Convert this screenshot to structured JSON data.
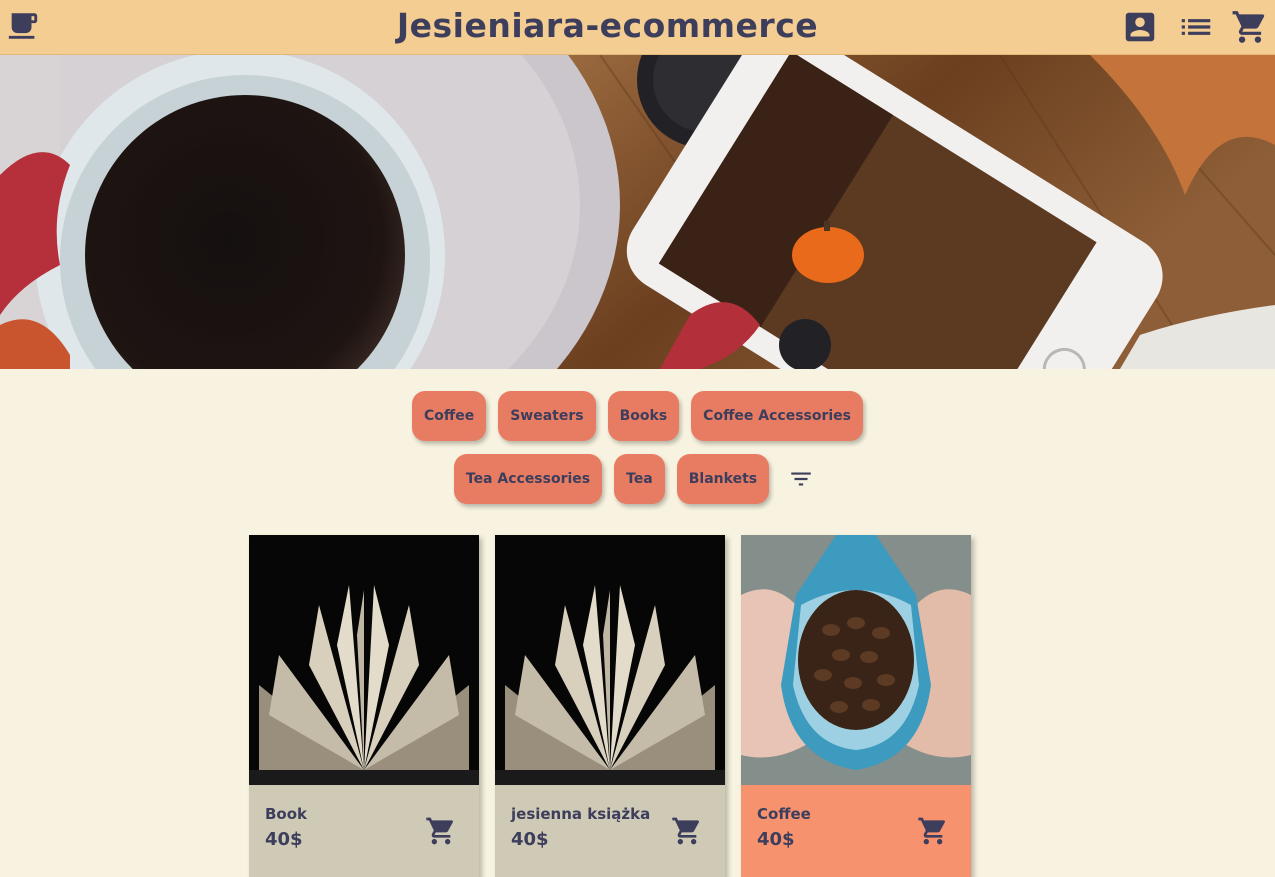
{
  "header": {
    "title": "Jesieniara-ecommerce",
    "logo_icon": "coffee-cup-icon",
    "icons": [
      "account-box-icon",
      "list-icon",
      "shopping-cart-icon"
    ]
  },
  "categories": {
    "row1": [
      "Coffee",
      "Sweaters",
      "Books",
      "Coffee Accessories"
    ],
    "row2": [
      "Tea Accessories",
      "Tea",
      "Blankets"
    ],
    "filter_icon": "filter-list-icon"
  },
  "products": [
    {
      "name": "Book",
      "price": "40$",
      "image": "open-book-photo"
    },
    {
      "name": "jesienna książka",
      "price": "40$",
      "image": "open-book-photo"
    },
    {
      "name": "Coffee",
      "price": "40$",
      "image": "coffee-beans-bag-photo"
    }
  ],
  "colors": {
    "header_bg": "#f3cd91",
    "page_bg": "#f8f3e0",
    "chip_bg": "#e77c63",
    "text": "#3d3d5c",
    "card_info_bg": "#cfcab6",
    "card_info_highlight": "#f7926f"
  }
}
